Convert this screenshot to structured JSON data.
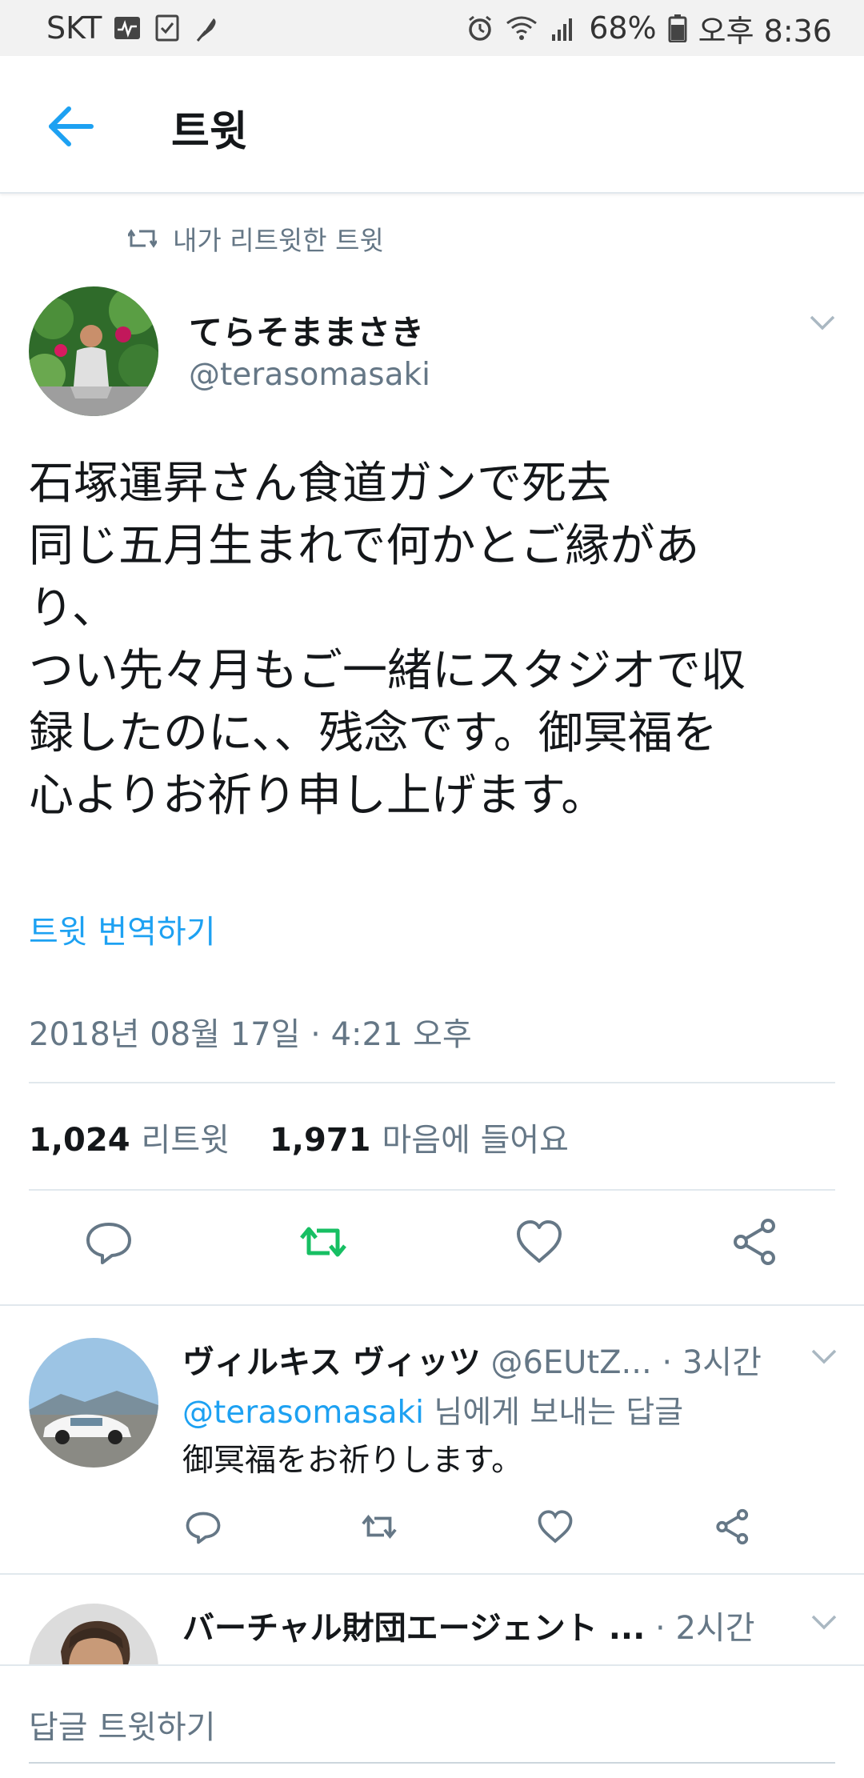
{
  "status_bar": {
    "carrier": "SKT",
    "battery": "68%",
    "time": "오후 8:36"
  },
  "app_bar": {
    "title": "트윗"
  },
  "retweet_context": "내가 리트윗한 트윗",
  "tweet": {
    "display_name": "てらそままさき",
    "handle": "@terasomasaki",
    "text_lines": [
      "石塚運昇さん食道ガンで死去",
      "同じ五月生まれで何かとご縁があ",
      "り、",
      "つい先々月もご一緒にスタジオで収",
      "録したのに、、残念です。御冥福を",
      "心よりお祈り申し上げます。"
    ],
    "translate_label": "트윗 번역하기",
    "timestamp": "2018년 08월 17일 · 4:21 오후",
    "retweet_count": "1,024",
    "retweet_label": "리트윗",
    "like_count": "1,971",
    "like_label": "마음에 들어요"
  },
  "replies": [
    {
      "display_name": "ヴィルキス ヴィッツ",
      "handle": "@6EUtZ...",
      "time": "· 3시간",
      "reply_to_handle": "@terasomasaki",
      "reply_to_suffix": " 님에게 보내는 답글",
      "text": "御冥福をお祈りします。"
    },
    {
      "display_name": "バーチャル財団エージェント ...",
      "time": "· 2시간"
    }
  ],
  "compose": {
    "placeholder": "답글 트윗하기"
  },
  "colors": {
    "accent": "#1da1f2",
    "retweet_active": "#17bf63",
    "secondary_text": "#657786"
  }
}
